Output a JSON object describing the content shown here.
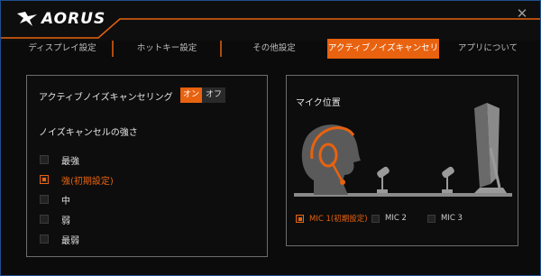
{
  "app": {
    "logo_text": "AORUS"
  },
  "tabs": [
    {
      "label": "ディスプレイ設定",
      "active": false
    },
    {
      "label": "ホットキー設定",
      "active": false
    },
    {
      "label": "その他設定",
      "active": false
    },
    {
      "label": "アクティブノイズキャンセリング",
      "active": true
    },
    {
      "label": "アプリについて",
      "active": false
    }
  ],
  "anc": {
    "title": "アクティブノイズキャンセリング",
    "toggle_on": "オン",
    "toggle_off": "オフ",
    "state": "on",
    "strength_title": "ノイズキャンセルの強さ",
    "levels": [
      {
        "label": "最強",
        "selected": false
      },
      {
        "label": "強(初期設定)",
        "selected": true
      },
      {
        "label": "中",
        "selected": false
      },
      {
        "label": "弱",
        "selected": false
      },
      {
        "label": "最弱",
        "selected": false
      }
    ]
  },
  "mic": {
    "title": "マイク位置",
    "options": [
      {
        "label": "MIC 1(初期設定)",
        "selected": true
      },
      {
        "label": "MIC 2",
        "selected": false
      },
      {
        "label": "MIC 3",
        "selected": false
      }
    ]
  },
  "colors": {
    "accent": "#e8620f",
    "panel_border": "#6d6d6d",
    "background": "#0b0b0b"
  }
}
